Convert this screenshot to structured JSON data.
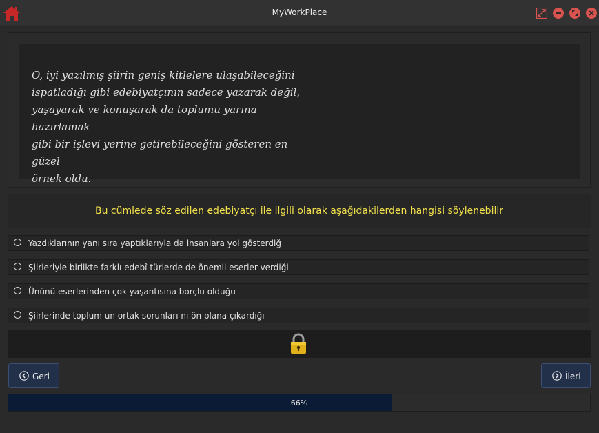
{
  "window": {
    "title": "MyWorkPlace",
    "icons": [
      "home-icon",
      "fullscreen-icon",
      "minimize-icon",
      "maximize-icon",
      "close-icon"
    ],
    "accent": "#d9534f"
  },
  "passage": {
    "lines": [
      "O, iyi yazılmış şiirin geniş kitlelere ulaşabileceğini",
      "ispatladığı gibi edebiyatçının sadece yazarak değil,",
      "yaşayarak ve konuşarak da toplumu yarına hazırlamak",
      "gibi bir işlevi yerine getirebileceğini gösteren en güzel",
      "örnek oldu."
    ]
  },
  "question": {
    "text": "Bu cümlede söz edilen edebiyatçı ile ilgili olarak  aşağıdakilerden hangisi söylenebilir",
    "color": "#f1e04b"
  },
  "options": [
    {
      "label": "Yazdıklarının yanı sıra yaptıklarıyla da  insanlara  yol  gösterdiğ"
    },
    {
      "label": "Şiirleriyle birlikte farklı edebî türlerde de önemli eserler verdiği"
    },
    {
      "label": "Ününü eserlerinden çok yaşantısına borçlu olduğu"
    },
    {
      "label": "Şiirlerinde toplum un ortak  sorunları nı ön plana çıkardığı"
    }
  ],
  "lock": {
    "icon": "lock-icon",
    "color": "#e0b11a"
  },
  "nav": {
    "back_label": "Geri",
    "next_label": "İleri",
    "back_icon": "chevron-left-circle-icon",
    "next_icon": "chevron-right-circle-icon"
  },
  "progress": {
    "value": 66,
    "text": "66%"
  }
}
